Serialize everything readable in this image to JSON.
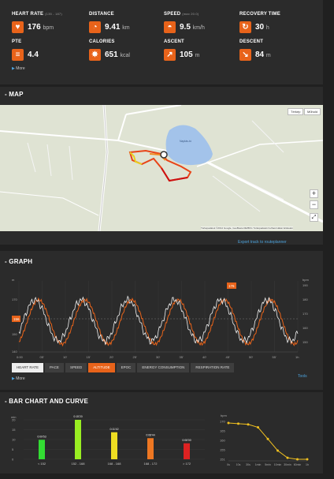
{
  "stats": [
    {
      "label": "HEART RATE",
      "sub": "(135 - 187)",
      "value": "176",
      "unit": "bpm",
      "icon": "heart-icon"
    },
    {
      "label": "DISTANCE",
      "sub": "",
      "value": "9.41",
      "unit": "km",
      "icon": "distance-icon"
    },
    {
      "label": "SPEED",
      "sub": "(max 20.0)",
      "value": "9.5",
      "unit": "km/h",
      "icon": "speedometer-icon"
    },
    {
      "label": "RECOVERY TIME",
      "sub": "",
      "value": "30",
      "unit": "h",
      "icon": "recovery-icon"
    },
    {
      "label": "PTE",
      "sub": "",
      "value": "4.4",
      "unit": "",
      "icon": "pte-icon"
    },
    {
      "label": "CALORIES",
      "sub": "",
      "value": "651",
      "unit": "kcal",
      "icon": "flame-icon"
    },
    {
      "label": "ASCENT",
      "sub": "",
      "value": "105",
      "unit": "m",
      "icon": "ascent-arrow-icon"
    },
    {
      "label": "DESCENT",
      "sub": "",
      "value": "84",
      "unit": "m",
      "icon": "descent-arrow-icon"
    }
  ],
  "more_label": "More",
  "map": {
    "title": "MAP",
    "type_buttons": [
      "Térkép",
      "Műhold"
    ],
    "zoom_in": "+",
    "zoom_out": "−",
    "lake_label": "Naplás-tó",
    "attribution": "Térképadatok ©2014 Google, GeoBasis-DE/BKG   Térképadatok  Felhasználási feltételek",
    "export_link": "Export track to routeplanner"
  },
  "graph": {
    "title": "GRAPH",
    "left_axis_top": "m",
    "right_axis_top": "bpm",
    "left_ticks": [
      "170",
      "160",
      "150",
      "140"
    ],
    "right_ticks": [
      "190",
      "180",
      "170",
      "160",
      "150"
    ],
    "x_ticks": [
      "0:00",
      "05'",
      "10'",
      "15'",
      "20'",
      "25'",
      "30'",
      "35'",
      "40'",
      "45'",
      "50'",
      "55'",
      "1h"
    ],
    "marker_left": "156",
    "marker_peak": "176",
    "tabs": [
      "HEART RATE",
      "PACE",
      "SPEED",
      "ALTITUDE",
      "EPOC",
      "ENERGY CONSUMPTION",
      "RESPIRATION RATE"
    ],
    "active_tab": "ALTITUDE",
    "tools": "Tools",
    "more": "More"
  },
  "chart_data": [
    {
      "type": "bar",
      "categories": [
        "< 152",
        "152 - 168",
        "168 - 168",
        "168 - 172",
        "> 172"
      ],
      "values": [
        9.88,
        20.7,
        13.7,
        10.7,
        8.1
      ],
      "labels": [
        "0:09'53",
        "0:15'20",
        "0:11'42",
        "0:08'44",
        "0:06'00"
      ],
      "colors": [
        "#33dd33",
        "#99ee22",
        "#eedd22",
        "#ee7722",
        "#dd2222"
      ],
      "ylabel": "min",
      "yticks": [
        "20",
        "15",
        "10",
        "5",
        "0"
      ],
      "ylim": [
        0,
        20
      ]
    },
    {
      "type": "line",
      "x": [
        "0s",
        "10s",
        "30s",
        "1min",
        "5min",
        "10min",
        "30min",
        "60min",
        "1h"
      ],
      "y": [
        176,
        175.5,
        175,
        173,
        165,
        157,
        152,
        151,
        151
      ],
      "color": "#f0c020",
      "yticks": [
        "170",
        "165",
        "160",
        "155",
        "151"
      ],
      "ylabel": "bpm"
    }
  ],
  "bar_section_title": "BAR CHART AND CURVE"
}
